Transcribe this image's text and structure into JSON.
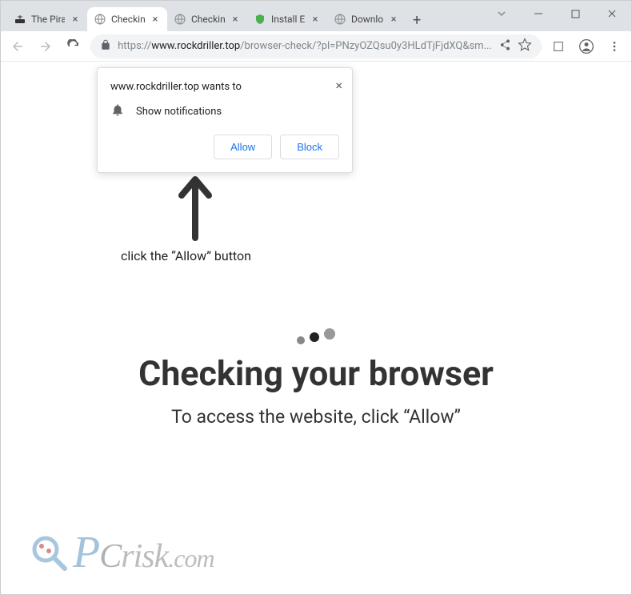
{
  "window": {
    "tabs": [
      {
        "title": "The Pira",
        "active": false,
        "icon": "ship"
      },
      {
        "title": "Checkin",
        "active": true,
        "icon": "globe"
      },
      {
        "title": "Checkin",
        "active": false,
        "icon": "globe"
      },
      {
        "title": "Install E",
        "active": false,
        "icon": "shield"
      },
      {
        "title": "Downlo",
        "active": false,
        "icon": "globe"
      }
    ]
  },
  "omnibox": {
    "protocol": "https://",
    "host": "www.rockdriller.top",
    "path": "/browser-check/?pl=PNzyOZQsu0y3HLdTjFjdXQ&sm..."
  },
  "permission": {
    "origin_text": "www.rockdriller.top wants to",
    "request": "Show notifications",
    "allow": "Allow",
    "block": "Block"
  },
  "page": {
    "hint": "click the “Allow” button",
    "heading": "Checking your browser",
    "subheading": "To access the website, click “Allow”"
  },
  "watermark": {
    "p": "P",
    "c": "C",
    "risk": "risk",
    "com": ".com"
  }
}
